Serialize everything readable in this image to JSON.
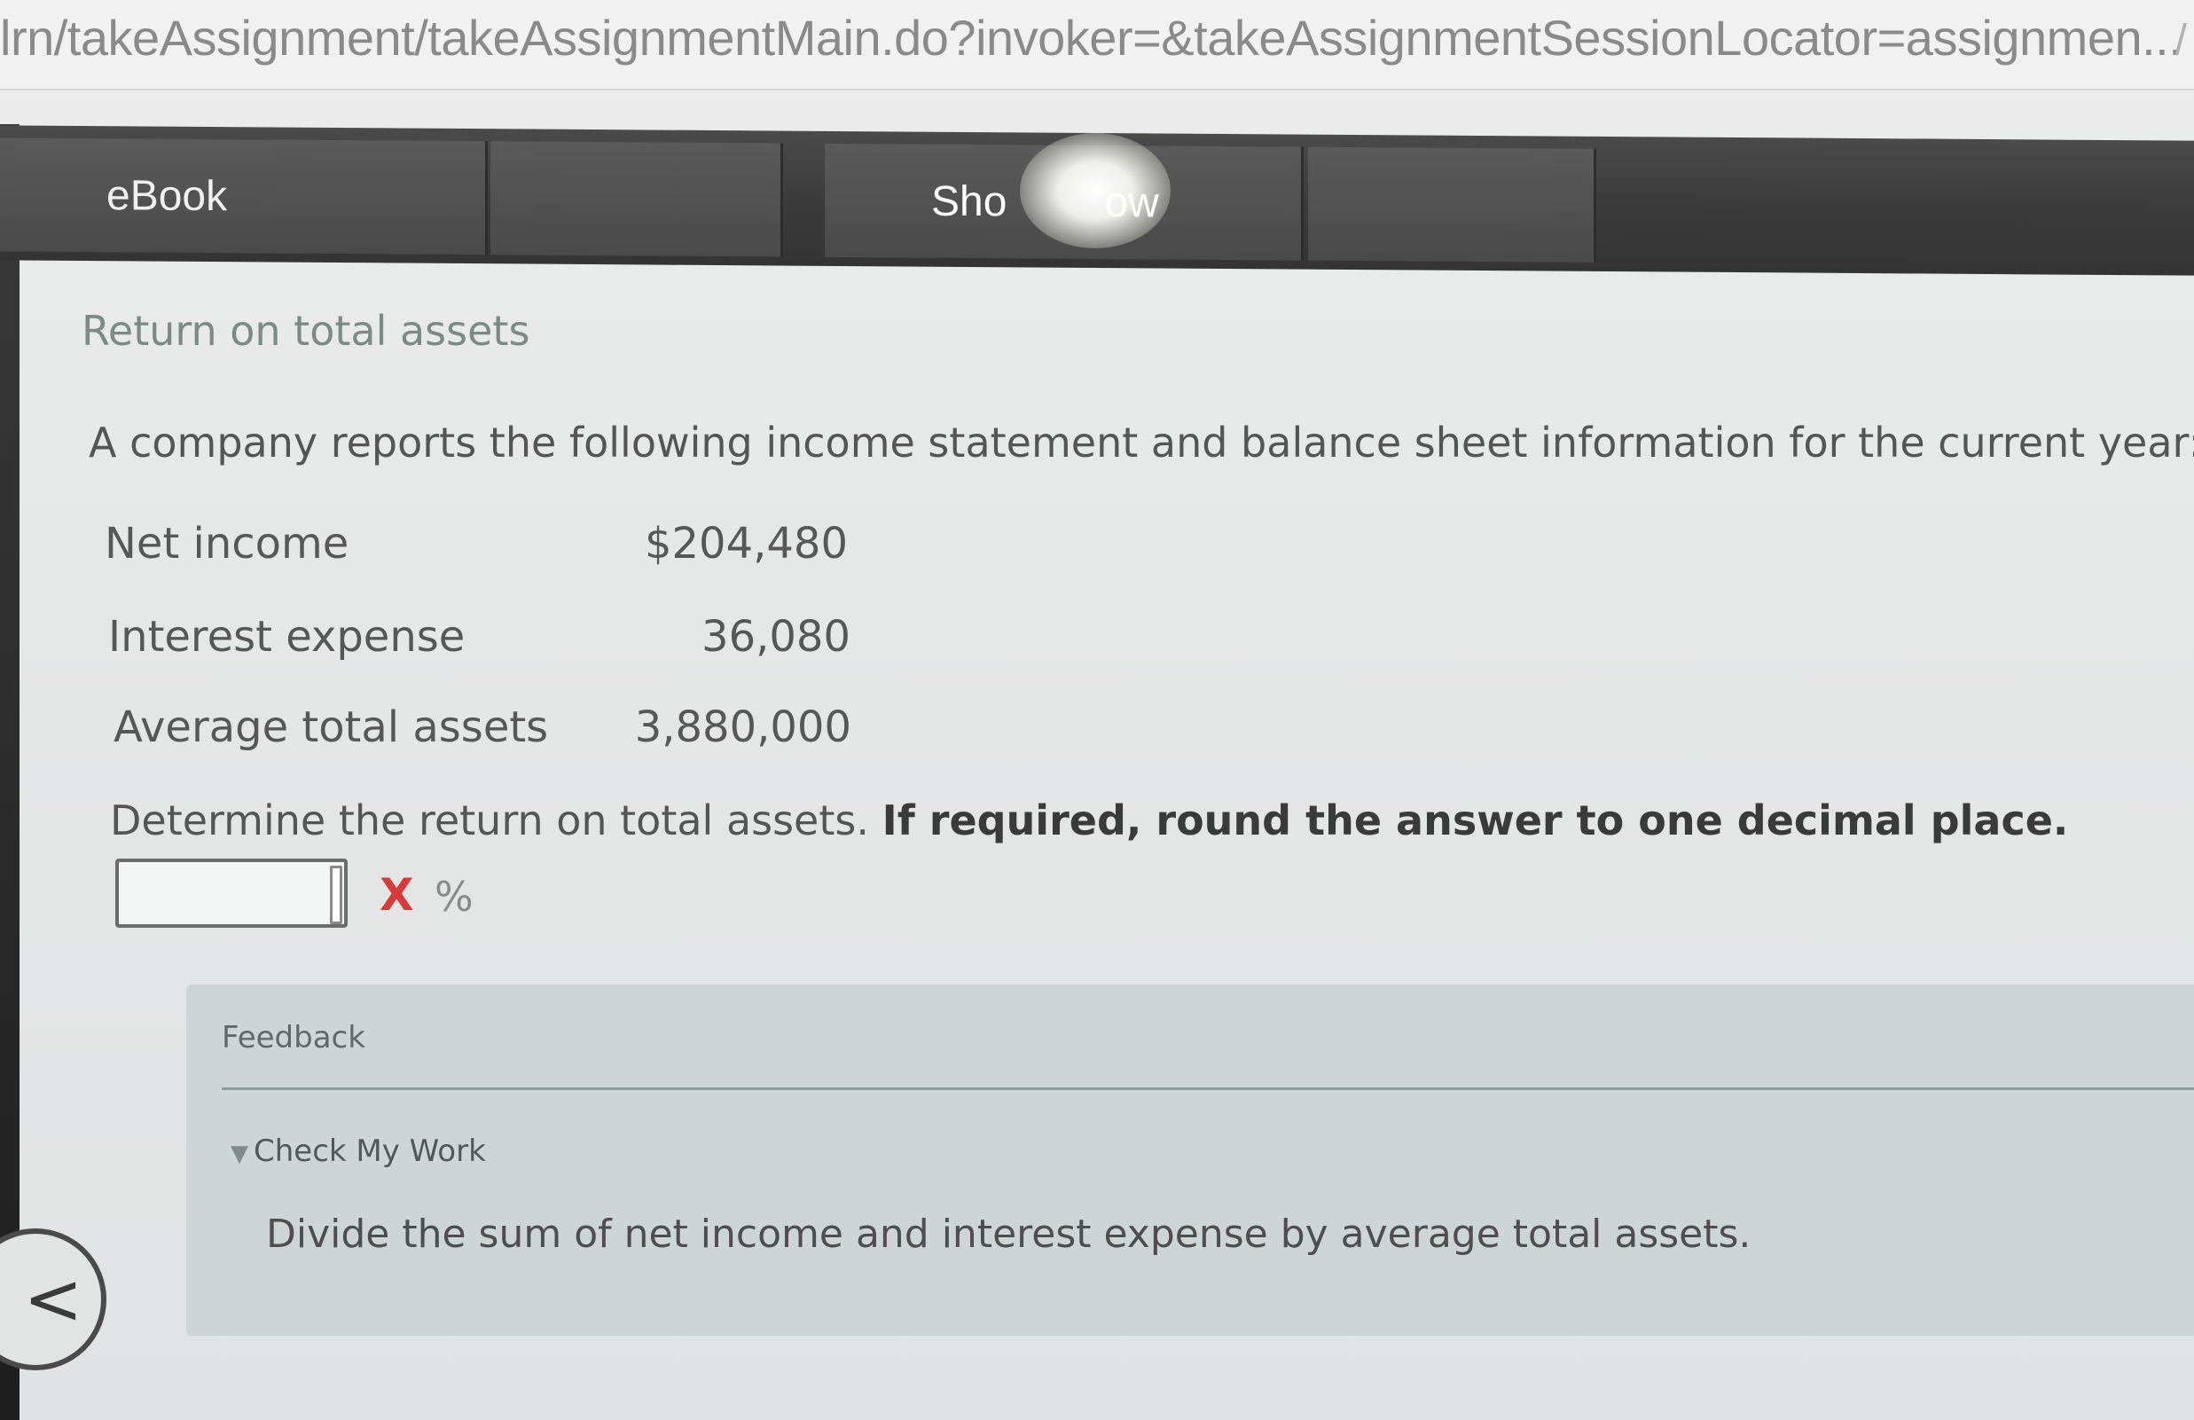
{
  "browser": {
    "url": "lrn/takeAssignment/takeAssignmentMain.do?invoker=&takeAssignmentSessionLocator=assignmen..."
  },
  "toolbar": {
    "ebook_label": "eBook",
    "show_label": "Sho",
    "show_label_tail": "ow"
  },
  "problem": {
    "title": "Return on total assets",
    "intro": "A company reports the following income statement and balance sheet information for the current year:",
    "rows": [
      {
        "label": "Net income",
        "value": "$204,480"
      },
      {
        "label": "Interest expense",
        "value": "36,080"
      },
      {
        "label": "Average total assets",
        "value": "3,880,000"
      }
    ],
    "question_plain": "Determine the return on total assets. ",
    "question_bold": "If required, round the answer to one decimal place.",
    "answer_value": "",
    "status_mark": "X",
    "unit": "%"
  },
  "feedback": {
    "title": "Feedback",
    "check_label": "Check My Work",
    "hint": "Divide the sum of net income and interest expense by average total assets."
  },
  "icons": {
    "back": "chevron-left-icon",
    "incorrect": "x-icon",
    "expand": "triangle-down-icon"
  },
  "colors": {
    "incorrect": "#d63a3a",
    "toolbar": "#3b3b3b",
    "feedback_bg": "#cdd6d4"
  }
}
